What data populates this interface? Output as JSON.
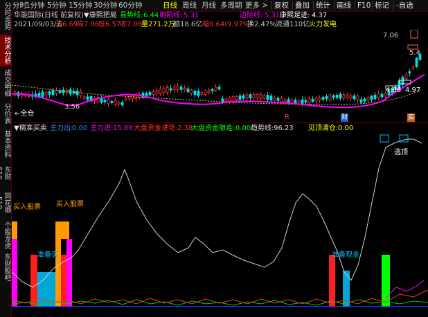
{
  "sidebar": {
    "tabs": [
      {
        "label": "分时走势",
        "active": false
      },
      {
        "label": "技术分析",
        "active": true
      },
      {
        "label": "成交明细",
        "active": false
      },
      {
        "label": "分价表",
        "active": false
      },
      {
        "label": "基本资料",
        "active": false
      },
      {
        "label": "东财F10",
        "active": false
      },
      {
        "label": "同花顺F10",
        "active": false
      },
      {
        "label": "个股龙虎",
        "active": false
      },
      {
        "label": "东财股吧",
        "active": false
      }
    ]
  },
  "toolbar": {
    "periods": [
      {
        "label": "分时",
        "selected": false
      },
      {
        "label": "1分钟",
        "selected": false
      },
      {
        "label": "5分钟",
        "selected": false
      },
      {
        "label": "15分钟",
        "selected": false
      },
      {
        "label": "30分钟",
        "selected": false
      },
      {
        "label": "60分钟",
        "selected": false
      },
      {
        "label": "日线",
        "selected": true
      },
      {
        "label": "周线",
        "selected": false
      },
      {
        "label": "月线",
        "selected": false
      },
      {
        "label": "多周期",
        "selected": false
      },
      {
        "label": "更多 >",
        "selected": false
      }
    ],
    "buttons": [
      "复权",
      "叠加",
      "统计",
      "画线",
      "F10",
      "标记",
      "-自选"
    ]
  },
  "info_row1": {
    "stock": "华能国际(日线 前复权)",
    "indicator": "▼康熙把局",
    "yishi_label": "易势线:",
    "yishi_value": "6.44",
    "chaoyang_label": "朝阳线:",
    "chaoyang_value": "5.31",
    "bianjie_label": "边际线:",
    "bianjie_value": "5.31",
    "kangxi_label": "康熙足迹:",
    "kangxi_value": "4.37"
  },
  "info_row2": {
    "date": "2021/09/03/五",
    "open": "开6.69",
    "high": "高7.06",
    "low": "低6.57",
    "close": "收7.06",
    "volume": "量271.2万",
    "amount": "额18.6亿",
    "change": "幅0.64(9.97%)",
    "turnover": "换2.47%",
    "float": "流通110亿",
    "concept": "火力发电"
  },
  "main_chart": {
    "labels": {
      "high_price": "7.06",
      "low_price": "3.56",
      "quanchang": "←全仓",
      "level_a": "4.86",
      "level_b": "4.97",
      "level_c": "5.4",
      "marker_r": "R",
      "marker_cai": "财",
      "marker_shi": "实"
    },
    "colors": {
      "up": "#ff3232",
      "down": "#00e0e0",
      "ma_main": "#ff00ff",
      "ma_slow": "#c8c864"
    }
  },
  "indicator_header": {
    "name": "▼精准买卖",
    "zhuli_chu_label": "主力出:",
    "zhuli_chu_value": "0.00",
    "zhuli_jin_label": "主力进:",
    "zhuli_jin_value": "15.88",
    "dapan_jin_label": "大盘资金进场:",
    "dapan_jin_value": "2.38",
    "dapan_che_label": "大盘资金撤走:",
    "dapan_che_value": "0.00",
    "qushi_label": "趋势线:",
    "qushi_value": "96.23",
    "jiandingqing_label": "见顶清仓:",
    "jiandingqing_value": "0.00"
  },
  "indicator_chart": {
    "labels": {
      "buy1": "买入股票",
      "buy2": "买入股票",
      "prep_buy": "准备买",
      "prep_cash": "准备现金",
      "top": "逃顶"
    },
    "colors": {
      "magenta": "#ff00ff",
      "red": "#ff1e1e",
      "orange": "#ff9a00",
      "cyan": "#00a8d8",
      "green": "#00ff00",
      "white_line": "#d0d0d0"
    }
  }
}
